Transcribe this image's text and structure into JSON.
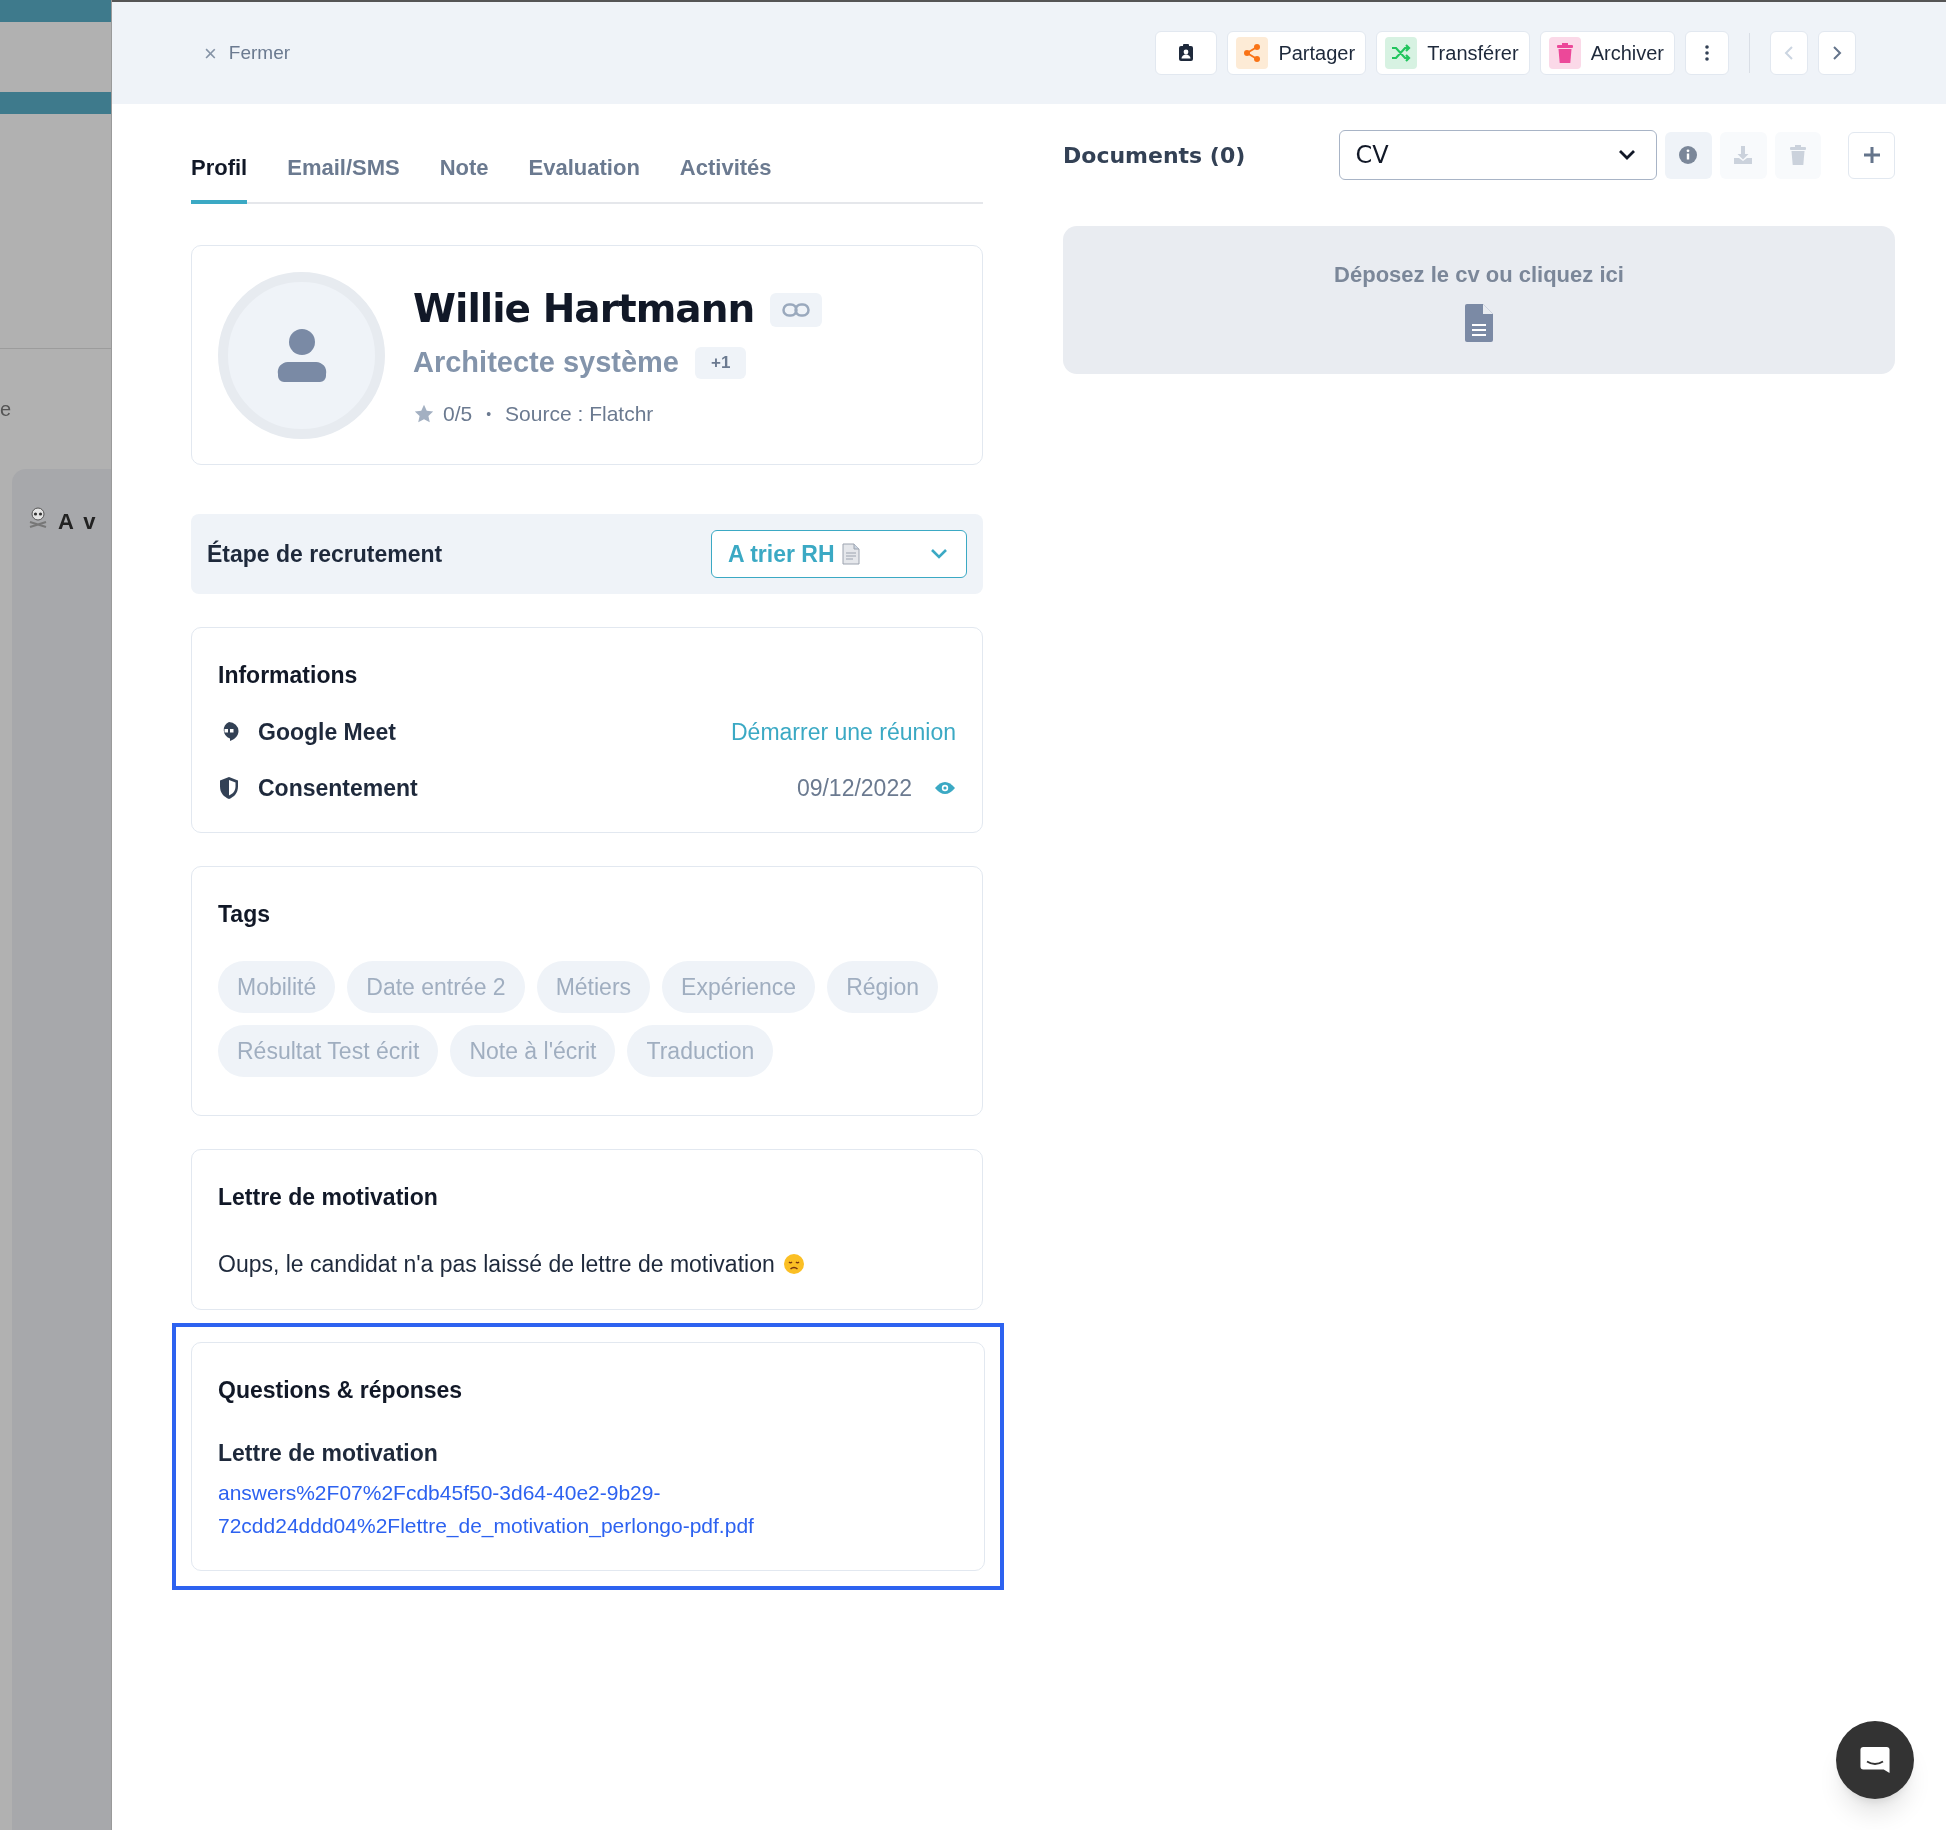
{
  "backdrop": {
    "side_text": "e",
    "card_label": "A v"
  },
  "header": {
    "close": {
      "icon": "×",
      "label": "Fermer"
    },
    "actions": [
      {
        "kind": "contact",
        "color": "#1e293b"
      },
      {
        "kind": "share",
        "label": "Partager",
        "color": "#f97316"
      },
      {
        "kind": "transfer",
        "label": "Transférer",
        "color": "#22c55e"
      },
      {
        "kind": "archive",
        "label": "Archiver",
        "color": "#ec4899"
      },
      {
        "kind": "more"
      }
    ],
    "nav": [
      {
        "kind": "prev",
        "disabled": true
      },
      {
        "kind": "next",
        "disabled": false
      }
    ]
  },
  "tabs": [
    {
      "label": "Profil",
      "selected": true
    },
    {
      "label": "Email/SMS",
      "selected": false
    },
    {
      "label": "Note",
      "selected": false
    },
    {
      "label": "Evaluation",
      "selected": false
    },
    {
      "label": "Activités",
      "selected": false
    }
  ],
  "profile": {
    "name": "Willie Hartmann",
    "title": "Architecte système",
    "title_extra": "+1",
    "rating": "0/5",
    "separator": "•",
    "source": "Source : Flatchr"
  },
  "stage": {
    "label": "Étape de recrutement",
    "value": "A trier RH"
  },
  "informations": {
    "title": "Informations",
    "rows": [
      {
        "kind": "meet",
        "label": "Google Meet",
        "action": "Démarrer une réunion"
      },
      {
        "kind": "consent",
        "label": "Consentement",
        "value": "09/12/2022"
      }
    ]
  },
  "tags": {
    "title": "Tags",
    "items": [
      "Mobilité",
      "Date entrée 2",
      "Métiers",
      "Expérience",
      "Région",
      "Résultat Test écrit",
      "Note à l'écrit",
      "Traduction"
    ]
  },
  "cover_letter": {
    "title": "Lettre de motivation",
    "text": "Oups, le candidat n'a pas laissé de lettre de motivation"
  },
  "qa": {
    "title": "Questions & réponses",
    "highlighted": true,
    "items": [
      {
        "question": "Lettre de motivation",
        "answer": "answers%2F07%2Fcdb45f50-3d64-40e2-9b29-72cdd24ddd04%2Flettre_de_motivation_perlongo-pdf.pdf"
      }
    ]
  },
  "documents": {
    "title": "Documents (0)",
    "type_select": "CV",
    "tools": [
      {
        "kind": "info",
        "disabled": false
      },
      {
        "kind": "download",
        "disabled": true
      },
      {
        "kind": "delete",
        "disabled": true
      },
      {
        "kind": "add",
        "disabled": false
      }
    ],
    "dropzone": "Déposez le cv ou cliquez ici"
  }
}
